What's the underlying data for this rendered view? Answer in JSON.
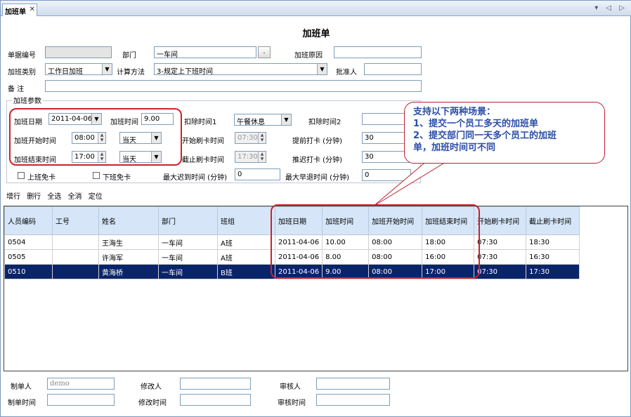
{
  "tab": {
    "label": "加班单",
    "close": "✕",
    "nav": "▾ ◁ ▷"
  },
  "form": {
    "title": "加班单",
    "doc_no_label": "单据编号",
    "doc_no_value": "",
    "dept_label": "部门",
    "dept_value": "一车间",
    "dept_btn": ".",
    "reason_label": "加班原因",
    "reason_value": "",
    "type_label": "加班类别",
    "type_value": "工作日加班",
    "calc_label": "计算方法",
    "calc_value": "3-规定上下班时间",
    "approver_label": "批准人",
    "approver_value": "",
    "remark_label": "备  注",
    "remark_value": ""
  },
  "params": {
    "group_label": "加班参数",
    "date_label": "加班日期",
    "date_value": "2011-04-06",
    "hours_label": "加班时间",
    "hours_value": "9.00",
    "deduct1_label": "扣除时间1",
    "deduct1_value": "午餐休息",
    "deduct2_label": "扣除时间2",
    "deduct2_value": "",
    "start_label": "加班开始时间",
    "start_value": "08:00",
    "start_day": "当天",
    "start_card_label": "开始刷卡时间",
    "start_card_value": "07:30",
    "early_label": "提前打卡 (分钟)",
    "early_value": "30",
    "end_label": "加班结束时间",
    "end_value": "17:00",
    "end_day": "当天",
    "end_card_label": "截止刷卡时间",
    "end_card_value": "17:30",
    "late_label": "推迟打卡 (分钟)",
    "late_value": "30",
    "exempt_on_label": "上班免卡",
    "exempt_off_label": "下班免卡",
    "max_late_label": "最大迟到时间 (分钟)",
    "max_late_value": "0",
    "max_early_label": "最大早退时间 (分钟)",
    "max_early_value": "0"
  },
  "toolbar": {
    "add": "增行",
    "delete": "删行",
    "select_all": "全选",
    "clear_all": "全消",
    "locate": "定位"
  },
  "grid": {
    "headers": [
      "人员编码",
      "工号",
      "姓名",
      "部门",
      "班组",
      "加班日期",
      "加班时间",
      "加班开始时间",
      "加班结束时间",
      "开始刷卡时间",
      "截止刷卡时间"
    ],
    "rows": [
      [
        "0504",
        "",
        "王海生",
        "一车间",
        "A班",
        "2011-04-06",
        "10.00",
        "08:00",
        "18:00",
        "07:30",
        "18:30"
      ],
      [
        "0505",
        "",
        "许海军",
        "一车间",
        "A班",
        "2011-04-06",
        "8.00",
        "08:00",
        "16:00",
        "07:30",
        "16:30"
      ],
      [
        "0510",
        "",
        "黄海桥",
        "一车间",
        "B班",
        "2011-04-06",
        "9.00",
        "08:00",
        "17:00",
        "07:30",
        "17:30"
      ]
    ]
  },
  "footer": {
    "creator_label": "制单人",
    "creator_value": "demo",
    "modifier_label": "修改人",
    "modifier_value": "",
    "auditor_label": "审核人",
    "auditor_value": "",
    "create_time_label": "制单时间",
    "create_time_value": "",
    "modify_time_label": "修改时间",
    "modify_time_value": "",
    "audit_time_label": "审核时间",
    "audit_time_value": ""
  },
  "callout": {
    "line1": "支持以下两种场景：",
    "line2": "1、提交一个员工多天的加班单",
    "line3": "2、提交部门同一天多个员工的加班",
    "line4": "单，加班时间可不同"
  },
  "colors": {
    "accent_red": "#d0202a",
    "callout_text": "#2a4ea8",
    "header_bg": "#d6e6f8",
    "selected_row": "#0a246a"
  }
}
